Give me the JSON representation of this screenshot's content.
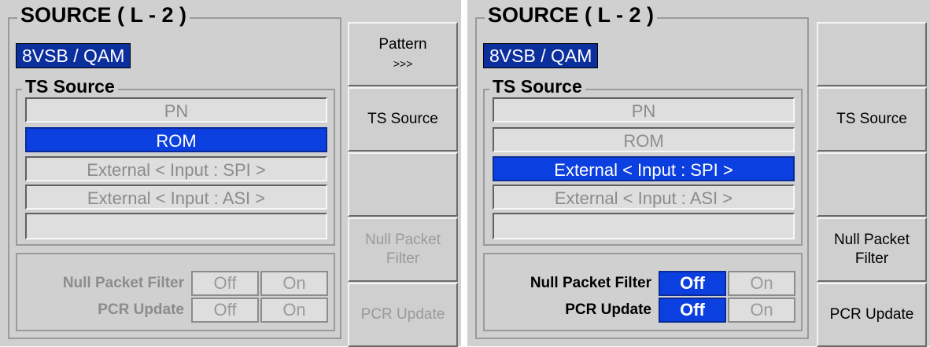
{
  "left": {
    "title": "SOURCE ( L - 2 )",
    "mode": "8VSB / QAM",
    "ts_title": "TS Source",
    "ts_items": [
      "PN",
      "ROM",
      "External < Input : SPI >",
      "External < Input : ASI >",
      ""
    ],
    "ts_selected": 1,
    "rows": [
      {
        "label": "Null Packet Filter",
        "off": "Off",
        "on": "On"
      },
      {
        "label": "PCR Update",
        "off": "Off",
        "on": "On"
      }
    ],
    "softkeys": [
      {
        "line1": "Pattern",
        "line2": ">>>",
        "dim": false
      },
      {
        "line1": "TS Source",
        "line2": "",
        "dim": false
      },
      {
        "line1": "",
        "line2": "",
        "dim": false
      },
      {
        "line1": "Null Packet",
        "line2": "Filter",
        "dim": true
      },
      {
        "line1": "PCR Update",
        "line2": "",
        "dim": true
      }
    ]
  },
  "right": {
    "title": "SOURCE ( L - 2 )",
    "mode": "8VSB / QAM",
    "ts_title": "TS Source",
    "ts_items": [
      "PN",
      "ROM",
      "External < Input : SPI >",
      "External < Input : ASI >",
      ""
    ],
    "ts_selected": 2,
    "rows": [
      {
        "label": "Null Packet Filter",
        "off": "Off",
        "on": "On"
      },
      {
        "label": "PCR Update",
        "off": "Off",
        "on": "On"
      }
    ],
    "softkeys": [
      {
        "line1": "",
        "line2": "",
        "dim": false
      },
      {
        "line1": "TS Source",
        "line2": "",
        "dim": false
      },
      {
        "line1": "",
        "line2": "",
        "dim": false
      },
      {
        "line1": "Null Packet",
        "line2": "Filter",
        "dim": false
      },
      {
        "line1": "PCR Update",
        "line2": "",
        "dim": false
      }
    ]
  },
  "colors": {
    "selected": "#0c3fe0",
    "mode_bg": "#0c2f9e",
    "panel_bg": "#d0d0d0"
  }
}
